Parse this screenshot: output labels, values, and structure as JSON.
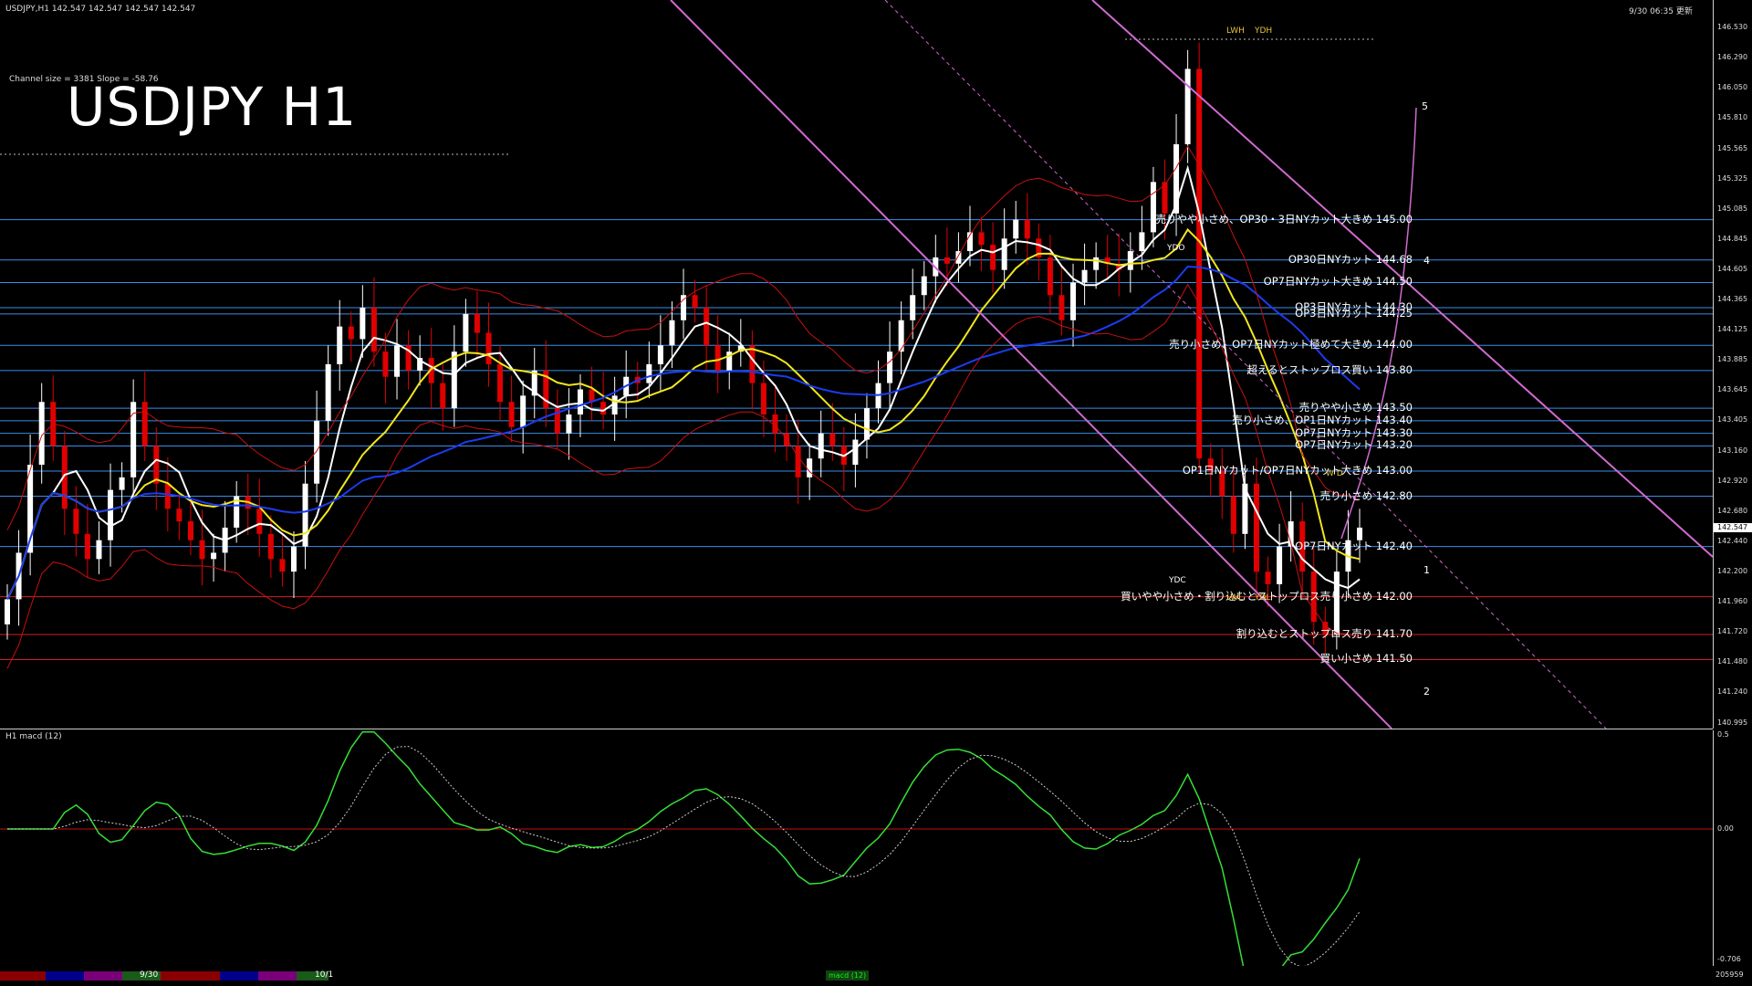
{
  "header": {
    "symbol_info": "USDJPY,H1  142.547 142.547 142.547 142.547",
    "clock": "9/30 06:35 更新",
    "channel_info": "Channel size = 3381 Slope = -58.76",
    "big_title": "USDJPY H1",
    "macd_label": "H1  macd (12)"
  },
  "price_axis": {
    "ticks": [
      "146.530",
      "146.290",
      "146.050",
      "145.810",
      "145.565",
      "145.325",
      "145.085",
      "144.845",
      "144.605",
      "144.365",
      "144.125",
      "143.885",
      "143.645",
      "143.405",
      "143.160",
      "142.920",
      "142.680",
      "142.440",
      "142.200",
      "141.960",
      "141.720",
      "141.480",
      "141.240",
      "140.995"
    ],
    "last_price": "142.547"
  },
  "macd_axis": {
    "top": "0.5",
    "zero": "0.00",
    "bottom": "-0.706"
  },
  "levels": [
    {
      "text": "売りやや小さめ、OP30・3日NYカット大きめ 145.00",
      "price": 145.0,
      "color": "#3a8de8"
    },
    {
      "text": "OP30日NYカット 144.68",
      "price": 144.68,
      "color": "#3a8de8"
    },
    {
      "text": "OP7日NYカット大きめ 144.50",
      "price": 144.5,
      "color": "#3a8de8"
    },
    {
      "text": "OP3日NYカット 144.30",
      "price": 144.3,
      "color": "#3a8de8"
    },
    {
      "text": "OP3日NYカット 144.25",
      "price": 144.25,
      "color": "#3a8de8"
    },
    {
      "text": "売り小さめ、OP7日NYカット極めて大きめ 144.00",
      "price": 144.0,
      "color": "#3a8de8"
    },
    {
      "text": "超えるとストップロス買い 143.80",
      "price": 143.8,
      "color": "#3a8de8"
    },
    {
      "text": "売りやや小さめ 143.50",
      "price": 143.5,
      "color": "#3a8de8"
    },
    {
      "text": "売り小さめ、OP1日NYカット 143.40",
      "price": 143.4,
      "color": "#3a8de8"
    },
    {
      "text": "OP7日NYカット 143.30",
      "price": 143.3,
      "color": "#3a8de8"
    },
    {
      "text": "OP7日NYカット 143.20",
      "price": 143.2,
      "color": "#3a8de8"
    },
    {
      "text": "OP1日NYカット/OP7日NYカット大きめ 143.00",
      "price": 143.0,
      "color": "#3a8de8"
    },
    {
      "text": "売り小さめ 142.80",
      "price": 142.8,
      "color": "#3a8de8"
    },
    {
      "text": "OP7日NYカット 142.40",
      "price": 142.4,
      "color": "#3a8de8"
    },
    {
      "text": "買いやや小さめ・割り込むとストップロス売り小さめ 142.00",
      "price": 142.0,
      "color": "#d02020"
    },
    {
      "text": "割り込むとストップロス売り 141.70",
      "price": 141.7,
      "color": "#d02020"
    },
    {
      "text": "買い小さめ 141.50",
      "price": 141.5,
      "color": "#d02020"
    }
  ],
  "small_labels": {
    "ydo": "YDO",
    "ydc": "YDC",
    "lwh": "LWH",
    "ydh": "YDH",
    "lwl": "LWL",
    "ydl": "YDL",
    "wd": "W D"
  },
  "wave_numbers": [
    "1",
    "2",
    "4",
    "5"
  ],
  "bottom_bar": {
    "date1": "9/30",
    "date2": "10/1",
    "tab": "macd (12)",
    "right": "205959"
  },
  "colors": {
    "background": "#000000",
    "bull": "#ffffff",
    "bear": "#e00000",
    "sma_white": "#ffffff",
    "sma_yellow": "#f2e61c",
    "sma_blue": "#1a3cf0",
    "level_blue": "#3a8de8",
    "level_red": "#d02020",
    "channel": "#d06ad0",
    "macd_main": "#35e035",
    "macd_down": "#f07a98",
    "bollinger": "#c81010",
    "green_line": "#22c022"
  },
  "chart_data": {
    "type": "candlestick",
    "symbol": "USDJPY",
    "timeframe": "H1",
    "ylim": [
      140.995,
      146.53
    ],
    "last_price": 142.547,
    "closes": [
      141.98,
      142.35,
      143.05,
      143.55,
      143.2,
      142.7,
      142.5,
      142.3,
      142.45,
      142.85,
      142.95,
      143.55,
      143.2,
      142.9,
      142.7,
      142.6,
      142.45,
      142.3,
      142.35,
      142.55,
      142.8,
      142.7,
      142.5,
      142.3,
      142.2,
      142.4,
      142.9,
      143.4,
      143.85,
      144.15,
      144.05,
      144.3,
      143.95,
      143.75,
      144.0,
      143.8,
      143.9,
      143.7,
      143.5,
      143.95,
      144.25,
      144.1,
      143.85,
      143.55,
      143.35,
      143.6,
      143.8,
      143.5,
      143.3,
      143.45,
      143.65,
      143.55,
      143.45,
      143.6,
      143.75,
      143.7,
      143.85,
      144.0,
      144.2,
      144.4,
      144.3,
      144.0,
      143.8,
      143.95,
      144.0,
      143.7,
      143.45,
      143.3,
      143.2,
      142.95,
      143.1,
      143.3,
      143.2,
      143.05,
      143.25,
      143.5,
      143.7,
      143.95,
      144.2,
      144.4,
      144.55,
      144.7,
      144.65,
      144.75,
      144.9,
      144.8,
      144.6,
      144.85,
      145.0,
      144.85,
      144.7,
      144.4,
      144.2,
      144.5,
      144.6,
      144.7,
      144.65,
      144.6,
      144.75,
      144.9,
      145.3,
      145.05,
      145.6,
      146.2,
      143.1,
      143.0,
      142.8,
      142.5,
      142.9,
      142.2,
      142.1,
      142.4,
      142.6,
      142.2,
      141.8,
      141.7,
      142.2,
      142.45,
      142.55
    ]
  }
}
